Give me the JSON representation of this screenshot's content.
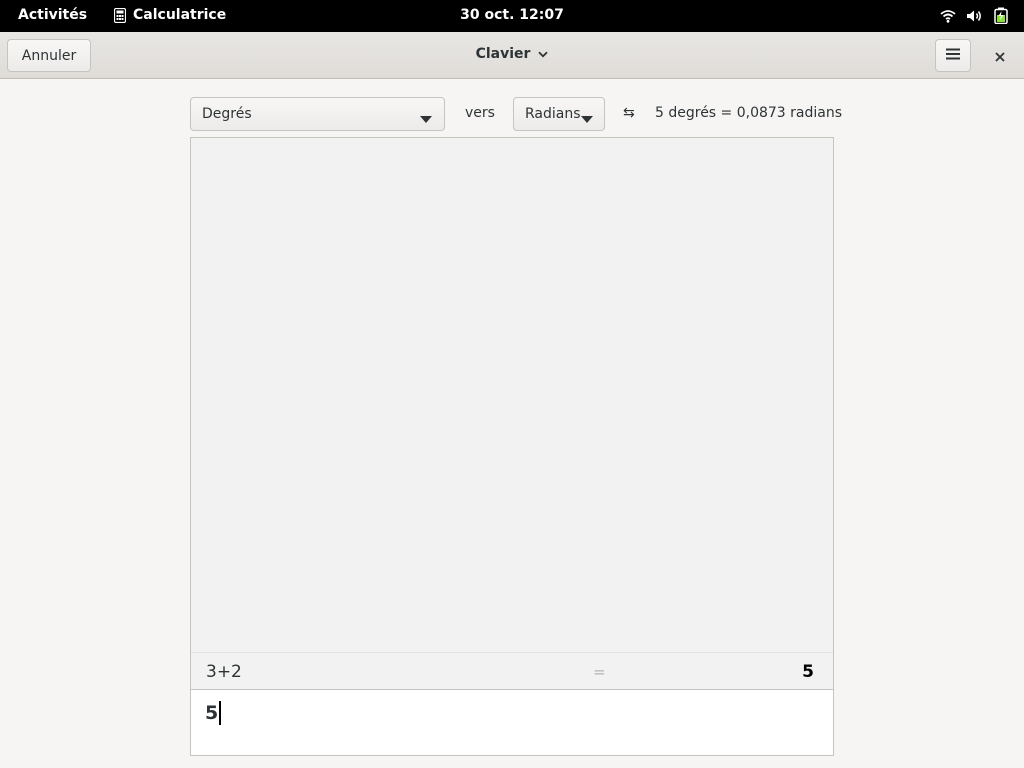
{
  "topbar": {
    "activities": "Activités",
    "app_name": "Calculatrice",
    "app_icon": "calculator-icon",
    "clock": "30 oct.  12:07",
    "tray_icons": [
      "wifi-icon",
      "volume-icon",
      "battery-icon"
    ]
  },
  "headerbar": {
    "cancel_label": "Annuler",
    "title": "Clavier",
    "menu_icon": "hamburger-menu-icon",
    "close_icon": "close-icon"
  },
  "conversion": {
    "from_unit": "Degrés",
    "to_word": "vers",
    "to_unit": "Radians",
    "swap_symbol": "⇆",
    "result_text": "5 degrés  =  0,0873 radians"
  },
  "history": {
    "expression": "3+2",
    "equals": "=",
    "value": "5"
  },
  "entry": {
    "value": "5"
  },
  "colors": {
    "topbar_bg": "#000000",
    "window_bg": "#f6f5f4",
    "display_bg": "#f2f2f2",
    "entry_bg": "#ffffff"
  }
}
